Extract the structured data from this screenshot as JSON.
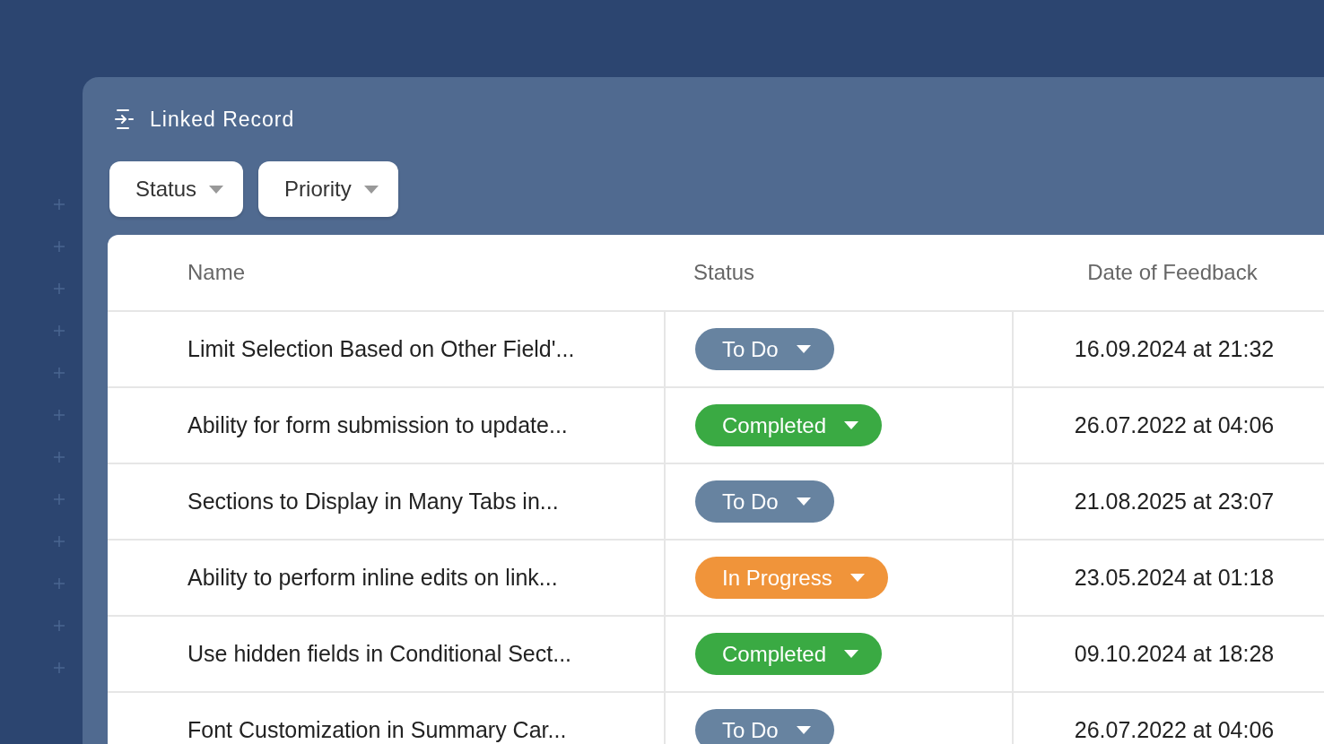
{
  "panel": {
    "title": "Linked Record"
  },
  "filters": [
    {
      "label": "Status"
    },
    {
      "label": "Priority"
    }
  ],
  "table": {
    "columns": [
      "Name",
      "Status",
      "Date of Feedback"
    ],
    "rows": [
      {
        "name": "Limit Selection Based on Other Field'...",
        "status": "To Do",
        "color": "#6783a0",
        "date": "16.09.2024 at 21:32"
      },
      {
        "name": "Ability for form submission to update...",
        "status": "Completed",
        "color": "#3aaa43",
        "date": "26.07.2022 at 04:06"
      },
      {
        "name": "Sections to Display in Many Tabs in...",
        "status": "To Do",
        "color": "#6783a0",
        "date": "21.08.2025 at 23:07"
      },
      {
        "name": "Ability to perform inline edits on link...",
        "status": "In Progress",
        "color": "#f0943a",
        "date": "23.05.2024 at 01:18"
      },
      {
        "name": "Use hidden fields in Conditional Sect...",
        "status": "Completed",
        "color": "#3aaa43",
        "date": "09.10.2024 at 18:28"
      },
      {
        "name": "Font Customization in Summary Car...",
        "status": "To Do",
        "color": "#6783a0",
        "date": "26.07.2022 at 04:06"
      }
    ]
  }
}
